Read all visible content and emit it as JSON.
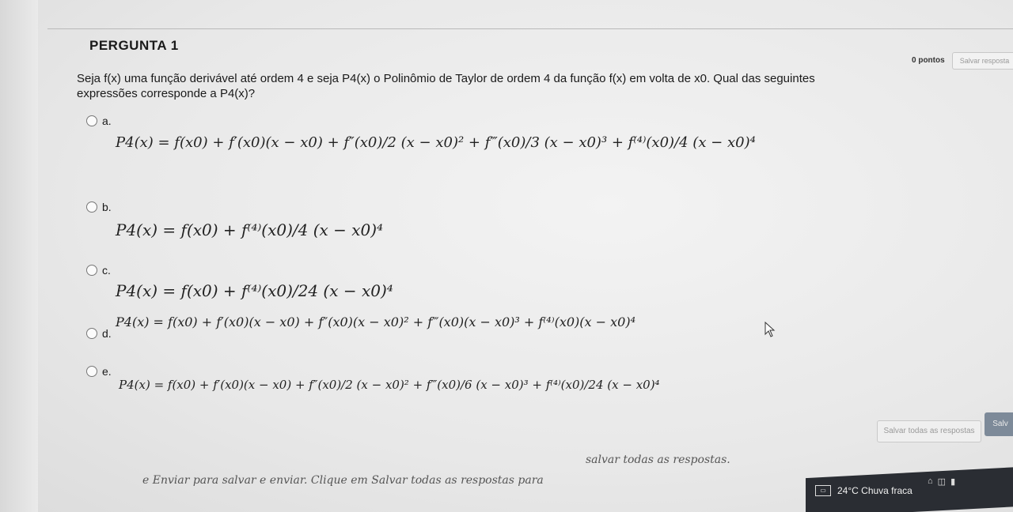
{
  "question": {
    "title": "PERGUNTA 1",
    "points": "0 pontos",
    "save_answer": "Salvar resposta",
    "stem_line1": "Seja f(x) uma função derivável até ordem 4 e seja P4(x) o Polinômio de Taylor de ordem 4 da função f(x) em volta de x0. Qual das seguintes",
    "stem_line2": "expressões corresponde a P4(x)?"
  },
  "options": [
    {
      "letter": "a.",
      "formula": "P4(x) = f(x0) + f′(x0)(x − x0) + f″(x0)/2 (x − x0)² + f‴(x0)/3 (x − x0)³ + f⁽⁴⁾(x0)/4 (x − x0)⁴"
    },
    {
      "letter": "b.",
      "formula": "P4(x) = f(x0) + f⁽⁴⁾(x0)/4 (x − x0)⁴"
    },
    {
      "letter": "c.",
      "formula": "P4(x) = f(x0) + f⁽⁴⁾(x0)/24 (x − x0)⁴"
    },
    {
      "letter": "d.",
      "formula": "P4(x) = f(x0) + f′(x0)(x − x0) + f″(x0)(x − x0)² + f‴(x0)(x − x0)³ + f⁽⁴⁾(x0)(x − x0)⁴"
    },
    {
      "letter": "e.",
      "formula": "P4(x) = f(x0) + f′(x0)(x − x0) + f″(x0)/2 (x − x0)² + f‴(x0)/6 (x − x0)³ + f⁽⁴⁾(x0)/24 (x − x0)⁴"
    }
  ],
  "footer": {
    "save_all": "Salvar todas as respostas",
    "submit": "Salv",
    "note_part1": "e Enviar para salvar e enviar. Clique em Salvar todas as respostas para",
    "note_part2": "salvar todas as respostas."
  },
  "taskbar": {
    "weather": "24°C  Chuva fraca"
  }
}
